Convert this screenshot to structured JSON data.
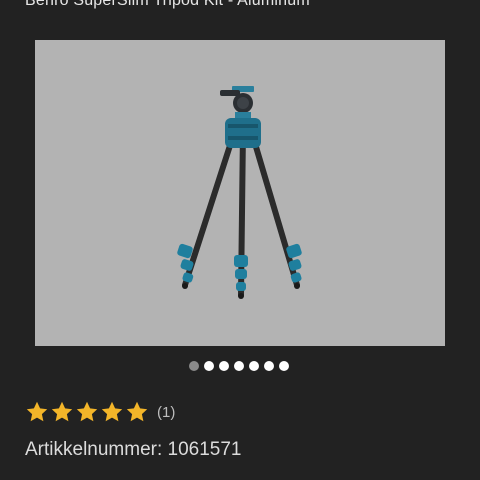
{
  "product": {
    "title": "Benro SuperSlim Tripod Kit - Aluminum",
    "image_alt": "tripod-photo"
  },
  "gallery": {
    "total_images": 7,
    "active_index": 0
  },
  "rating": {
    "value": 5,
    "max": 5,
    "count_label": "(1)",
    "star_color": "#f3b529"
  },
  "details": {
    "sku_label": "Artikkelnummer: 1061571"
  },
  "colors": {
    "background": "#222222",
    "image_background": "#b3b3b3",
    "accent": "#1f6f8b"
  }
}
